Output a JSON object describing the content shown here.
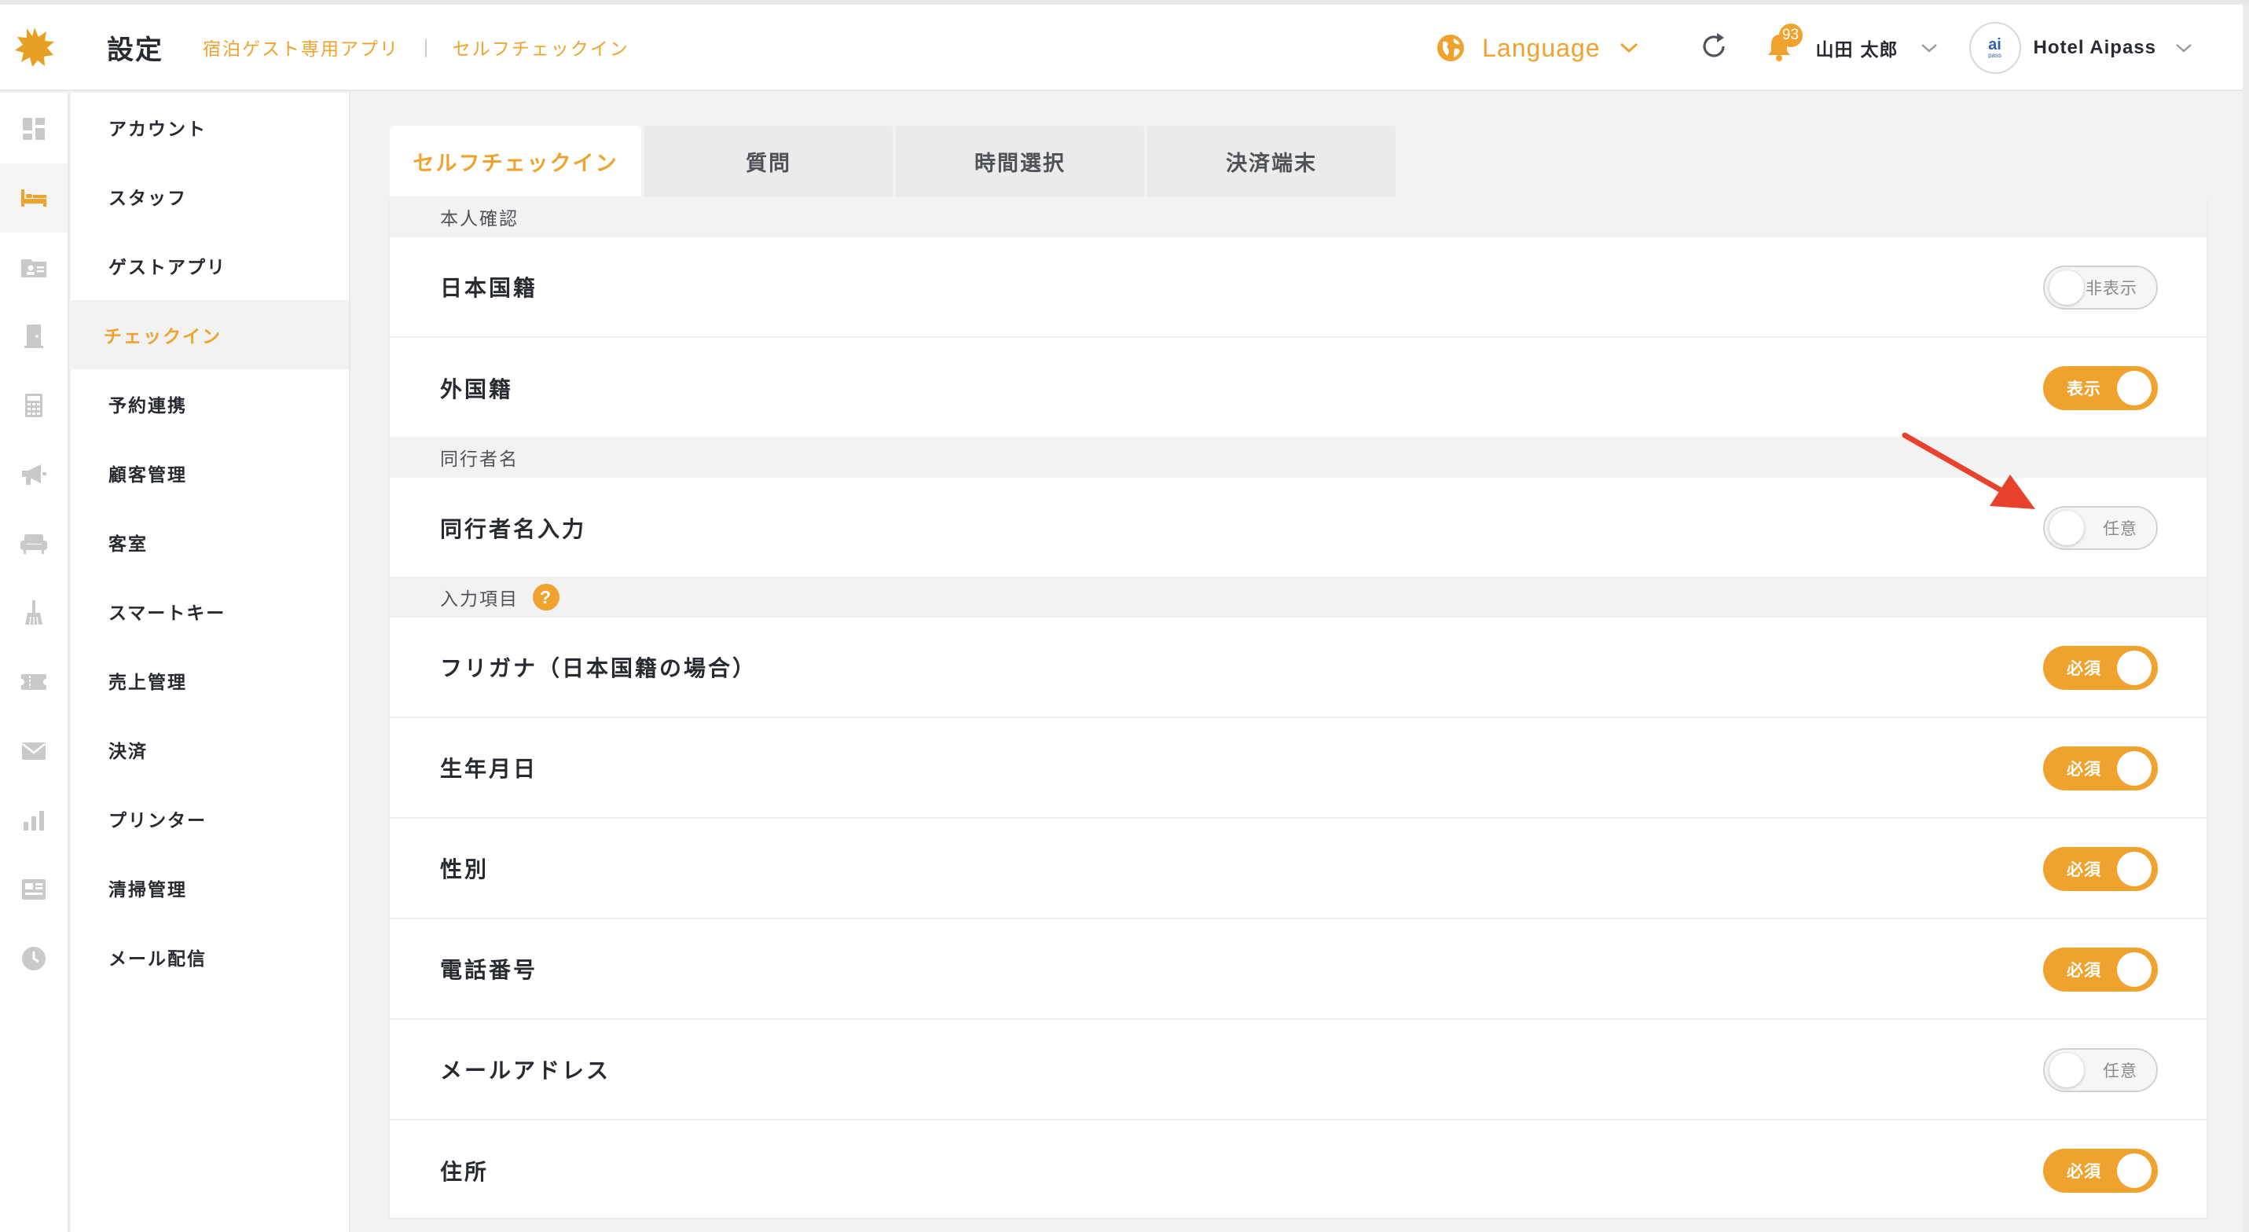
{
  "header": {
    "title": "設定",
    "breadcrumbs": [
      "宿泊ゲスト専用アプリ",
      "セルフチェックイン"
    ],
    "language_label": "Language",
    "notification_count": "93",
    "user_name": "山田 太郎",
    "hotel_logo_text": "ai",
    "hotel_logo_sub": "pass",
    "hotel_name": "Hotel Aipass"
  },
  "rail": {
    "icons": [
      "dashboard-icon",
      "bed-icon",
      "id-card-icon",
      "door-icon",
      "calculator-icon",
      "megaphone-icon",
      "sofa-icon",
      "broom-icon",
      "ticket-icon",
      "mail-icon",
      "bar-chart-icon",
      "news-icon",
      "clock-icon"
    ],
    "active_index": 1
  },
  "menu": {
    "items": [
      "アカウント",
      "スタッフ",
      "ゲストアプリ",
      "チェックイン",
      "予約連携",
      "顧客管理",
      "客室",
      "スマートキー",
      "売上管理",
      "決済",
      "プリンター",
      "清掃管理",
      "メール配信"
    ],
    "active": "チェックイン"
  },
  "tabs": {
    "items": [
      "セルフチェックイン",
      "質問",
      "時間選択",
      "決済端末"
    ],
    "active": "セルフチェックイン"
  },
  "sections": {
    "identity": {
      "title": "本人確認",
      "rows": [
        {
          "label": "日本国籍",
          "toggle_text": "非表示",
          "on": false
        },
        {
          "label": "外国籍",
          "toggle_text": "表示",
          "on": true
        }
      ]
    },
    "companion": {
      "title": "同行者名",
      "rows": [
        {
          "label": "同行者名入力",
          "toggle_text": "任意",
          "on": false
        }
      ]
    },
    "fields": {
      "title": "入力項目",
      "help_symbol": "?",
      "rows": [
        {
          "label": "フリガナ（日本国籍の場合）",
          "toggle_text": "必須",
          "on": true
        },
        {
          "label": "生年月日",
          "toggle_text": "必須",
          "on": true
        },
        {
          "label": "性別",
          "toggle_text": "必須",
          "on": true
        },
        {
          "label": "電話番号",
          "toggle_text": "必須",
          "on": true
        },
        {
          "label": "メールアドレス",
          "toggle_text": "任意",
          "on": false
        },
        {
          "label": "住所",
          "toggle_text": "必須",
          "on": true
        }
      ]
    }
  },
  "colors": {
    "accent": "#f0a22e",
    "annotation_arrow": "#e8412c",
    "text": "#272a31"
  }
}
